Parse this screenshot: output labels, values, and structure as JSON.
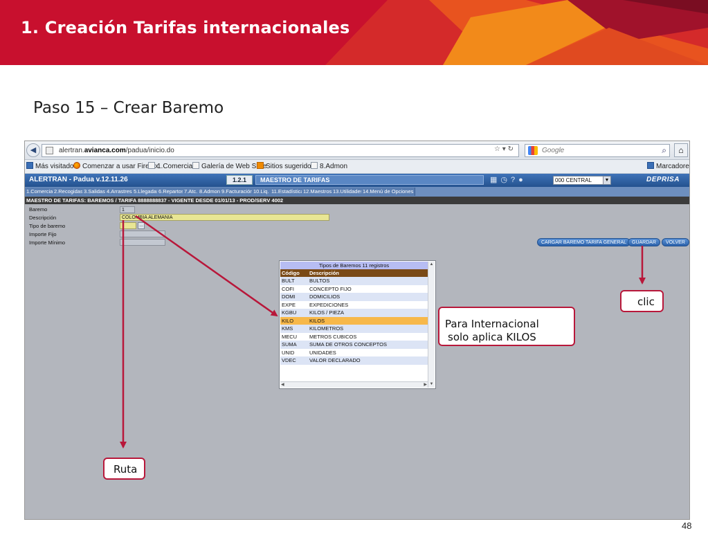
{
  "slide": {
    "title": "1. Creación Tarifas internacionales",
    "step": "Paso 15 – Crear Baremo",
    "page_number": "48"
  },
  "browser": {
    "url_prefix": "alertran.",
    "url_domain": "avianca.com",
    "url_path": "/padua/inicio.do",
    "search_placeholder": "Google",
    "bookmarks": [
      {
        "label": "Más visitados",
        "icon": "bookmarks-icon"
      },
      {
        "label": "Comenzar a usar Firefox",
        "icon": "firefox-icon"
      },
      {
        "label": "1.Comercial",
        "icon": "page-icon"
      },
      {
        "label": "Galería de Web Slice",
        "icon": "page-icon"
      },
      {
        "label": "Sitios sugeridos",
        "icon": "web-slice-icon"
      },
      {
        "label": "8.Admon",
        "icon": "page-icon"
      }
    ],
    "bookmarks_menu": "Marcadores"
  },
  "app": {
    "title": "ALERTRAN - Padua  v.12.11.26",
    "version": "1.2.1",
    "module": "MAESTRO DE TARIFAS",
    "office": "000 CENTRAL",
    "brand": "DEPRISA",
    "menu": [
      "1.Comercial",
      "2.Recogidas",
      "3.Salidas",
      "4.Arrastres",
      "5.Llegadas",
      "6.Repartos",
      "7.Atc.",
      "8.Admon",
      "9.Facturación",
      "10.Liq.",
      "11.Estadística",
      "12.Maestros",
      "13.Utilidades",
      "14.Menú de Opciones"
    ],
    "breadcrumb": "MAESTRO DE TARIFAS: BAREMOS   /   TARIFA 8888888837   -   VIGENTE DESDE 01/01/13   -   PROD/SERV 4002"
  },
  "form": {
    "baremo_label": "Baremo",
    "baremo_value": "1",
    "descripcion_label": "Descripción",
    "descripcion_value": "COLOMBIA ALEMANIA",
    "tipo_label": "Tipo de baremo",
    "tipo_value": "",
    "importe_fijo_label": "Importe Fijo",
    "importe_fijo_value": "",
    "importe_minimo_label": "Importe Mínimo",
    "importe_minimo_value": ""
  },
  "buttons": {
    "cargar": "CARGAR BAREMO TARIFA GENERAL",
    "guardar": "GUARDAR",
    "volver": "VOLVER"
  },
  "popup": {
    "title": "Tipos de Baremos 11 registros",
    "col_codigo": "Código",
    "col_descripcion": "Descripción",
    "rows": [
      {
        "codigo": "BULT",
        "descripcion": "BULTOS"
      },
      {
        "codigo": "COFI",
        "descripcion": "CONCEPTO FIJO"
      },
      {
        "codigo": "DOMI",
        "descripcion": "DOMICILIOS"
      },
      {
        "codigo": "EXPE",
        "descripcion": "EXPEDICIONES"
      },
      {
        "codigo": "KGBU",
        "descripcion": "KILOS / PIEZA"
      },
      {
        "codigo": "KILO",
        "descripcion": "KILOS"
      },
      {
        "codigo": "KMS",
        "descripcion": "KILOMETROS"
      },
      {
        "codigo": "MECU",
        "descripcion": "METROS CUBICOS"
      },
      {
        "codigo": "SUMA",
        "descripcion": "SUMA DE OTROS CONCEPTOS"
      },
      {
        "codigo": "UNID",
        "descripcion": "UNIDADES"
      },
      {
        "codigo": "VDEC",
        "descripcion": "VALOR DECLARADO"
      }
    ],
    "selected_codigo": "KILO"
  },
  "annotations": {
    "clic": "clic",
    "internacional_line1": "Para Internacional",
    "internacional_line2": "solo aplica KILOS",
    "ruta": "Ruta"
  },
  "colors": {
    "banner_red": "#c8102e",
    "annotation_red": "#b8173a",
    "app_blue": "#24528f",
    "selected_row": "#f7b84a"
  }
}
